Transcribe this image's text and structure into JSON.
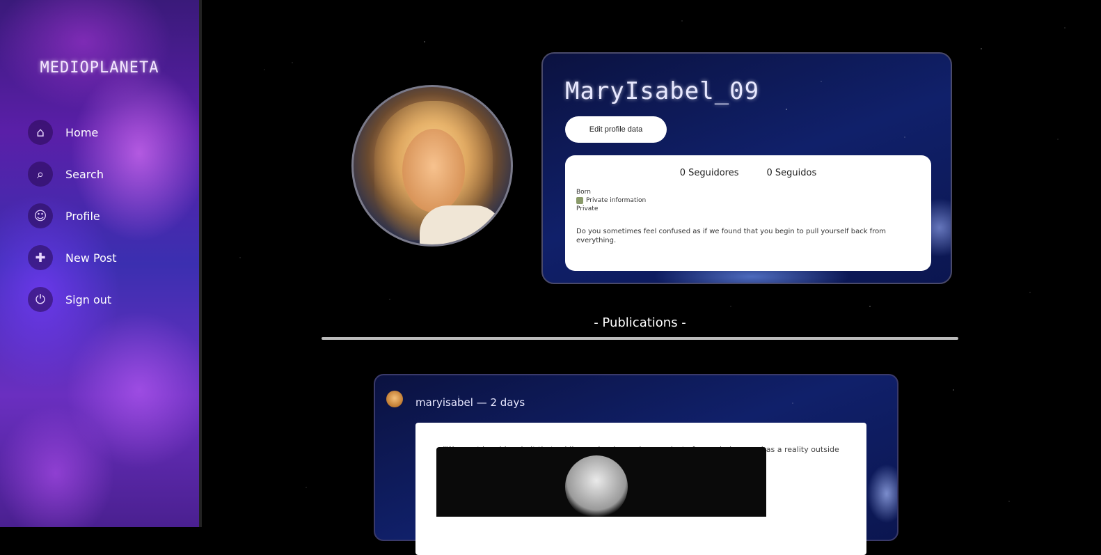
{
  "app": {
    "brand": "MEDIOPLANETA"
  },
  "sidebar": {
    "items": [
      {
        "label": "Home",
        "icon": "home-icon"
      },
      {
        "label": "Search",
        "icon": "search-icon"
      },
      {
        "label": "Profile",
        "icon": "profile-icon"
      },
      {
        "label": "New Post",
        "icon": "new-post-icon"
      },
      {
        "label": "Sign out",
        "icon": "sign-out-icon"
      }
    ]
  },
  "profile": {
    "username": "MaryIsabel_09",
    "edit_label": "Edit profile data",
    "followers": "0 Seguidores",
    "following": "0 Seguidos",
    "meta_line1": "Born",
    "meta_line2": "Private information",
    "meta_line3": "Private",
    "bio": "Do you sometimes feel confused as if we found that you begin to pull yourself back from everything."
  },
  "publications": {
    "title": "- Publications -"
  },
  "post": {
    "header": "maryisabel — 2 days",
    "quote": "\"We must humbly admit that, while number is purely a product of our mind, space has a reality outside our mind, so that we cannot fully prescribe its properties.\""
  },
  "colors": {
    "sidebar_accent": "#5a1fa8",
    "card_bg": "#10206a",
    "background": "#000000"
  }
}
